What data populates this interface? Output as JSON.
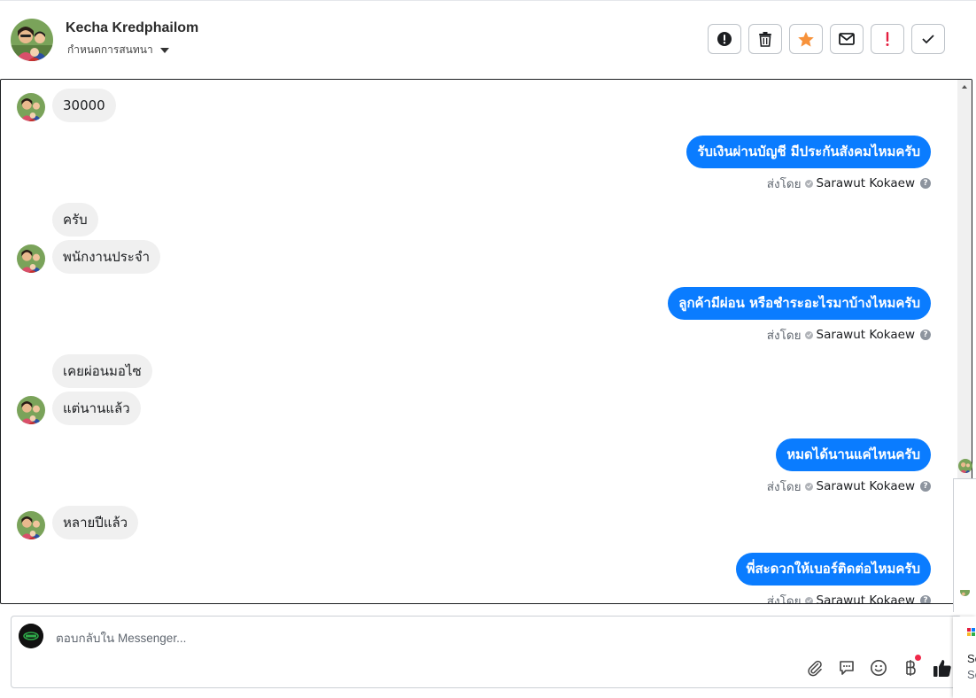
{
  "header": {
    "contact_name": "Kecha Kredphailom",
    "assign_label": "กำหนดการสนทนา",
    "actions": [
      {
        "name": "spam-button",
        "icon": "exclamation-circle-icon"
      },
      {
        "name": "delete-button",
        "icon": "trash-icon"
      },
      {
        "name": "star-button",
        "icon": "star-icon"
      },
      {
        "name": "mark-unread-button",
        "icon": "envelope-icon"
      },
      {
        "name": "follow-up-button",
        "icon": "exclamation-icon"
      },
      {
        "name": "mark-done-button",
        "icon": "check-icon"
      }
    ]
  },
  "conversation": {
    "sent_by_prefix": "ส่งโดย",
    "agent_name": "Sarawut Kokaew",
    "messages": [
      {
        "dir": "in",
        "text": "30000"
      },
      {
        "dir": "out",
        "text": "รับเงินผ่านบัญชี มีประกันสังคมไหมครับ"
      },
      {
        "dir": "in",
        "text": "ครับ"
      },
      {
        "dir": "in",
        "text": "พนักงานประจำ"
      },
      {
        "dir": "out",
        "text": "ลูกค้ามีผ่อน หรือชำระอะไรมาบ้างไหมครับ"
      },
      {
        "dir": "in",
        "text": "เคยผ่อนมอไซ"
      },
      {
        "dir": "in",
        "text": "แต่นานแล้ว"
      },
      {
        "dir": "out",
        "text": "หมดได้นานแค่ไหนครับ"
      },
      {
        "dir": "in",
        "text": "หลายปีแล้ว"
      },
      {
        "dir": "out",
        "text": "พี่สะดวกให้เบอร์ติดต่อไหมครับ"
      }
    ]
  },
  "composer": {
    "placeholder": "ตอบกลับใน Messenger...",
    "icons": [
      "paperclip-icon",
      "saved-reply-icon",
      "emoji-icon",
      "baht-payment-icon",
      "thumbs-up-icon"
    ]
  },
  "edge_panel": {
    "line1": "Se",
    "line2": "Se"
  },
  "colors": {
    "outgoing_bubble": "#0a7cff",
    "incoming_bubble": "#f0f0f0",
    "star": "#f7923b",
    "follow_up": "#e41e3f",
    "notification_dot": "#f02849"
  }
}
